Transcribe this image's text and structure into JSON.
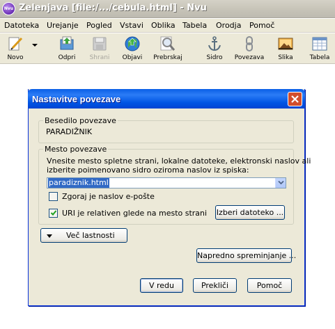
{
  "window": {
    "title": "Zelenjava [file:/.../cebula.html] - Nvu",
    "app_icon_text": "Nvu"
  },
  "menu": {
    "items": [
      "Datoteka",
      "Urejanje",
      "Pogled",
      "Vstavi",
      "Oblika",
      "Tabela",
      "Orodja",
      "Pomoč"
    ]
  },
  "toolbar": {
    "buttons": [
      {
        "label": "Novo",
        "icon": "new-page-pen-icon",
        "enabled": true
      },
      {
        "label": "Odpri",
        "icon": "open-folder-icon",
        "enabled": true
      },
      {
        "label": "Shrani",
        "icon": "save-disk-icon",
        "enabled": false
      },
      {
        "label": "Objavi",
        "icon": "publish-globe-icon",
        "enabled": true
      },
      {
        "label": "Prebrskaj",
        "icon": "browse-magnifier-icon",
        "enabled": true
      },
      {
        "label": "Sidro",
        "icon": "anchor-icon",
        "enabled": true
      },
      {
        "label": "Povezava",
        "icon": "chain-link-icon",
        "enabled": true
      },
      {
        "label": "Slika",
        "icon": "image-icon",
        "enabled": true
      },
      {
        "label": "Tabela",
        "icon": "table-icon",
        "enabled": true
      }
    ]
  },
  "dialog": {
    "title": "Nastavitve povezave",
    "link_text_group": {
      "legend": "Besedilo povezave",
      "value": "PARADIŽNIK"
    },
    "link_location_group": {
      "legend": "Mesto povezave",
      "instruction_line1": "Vnesite mesto spletne strani, lokalne datoteke, elektronski naslov ali",
      "instruction_line2": "izberite poimenovano sidro oziroma naslov iz spiska:",
      "url_value": "paradiznik.html",
      "email_checkbox_label": "Zgoraj je naslov e-pošte",
      "email_checked": false,
      "relative_checkbox_label": "URI je relativen glede na mesto strani",
      "relative_checked": true,
      "choose_file_button": "Izberi datoteko ..."
    },
    "more_properties_button": "Več lastnosti",
    "advanced_edit_button": "Napredno spreminjanje ...",
    "ok_button": "V redu",
    "cancel_button": "Prekliči",
    "help_button": "Pomoč"
  },
  "colors": {
    "dialog_title_bar": "#0055e4",
    "selection": "#316ac5",
    "close_button": "#d24e2c"
  }
}
